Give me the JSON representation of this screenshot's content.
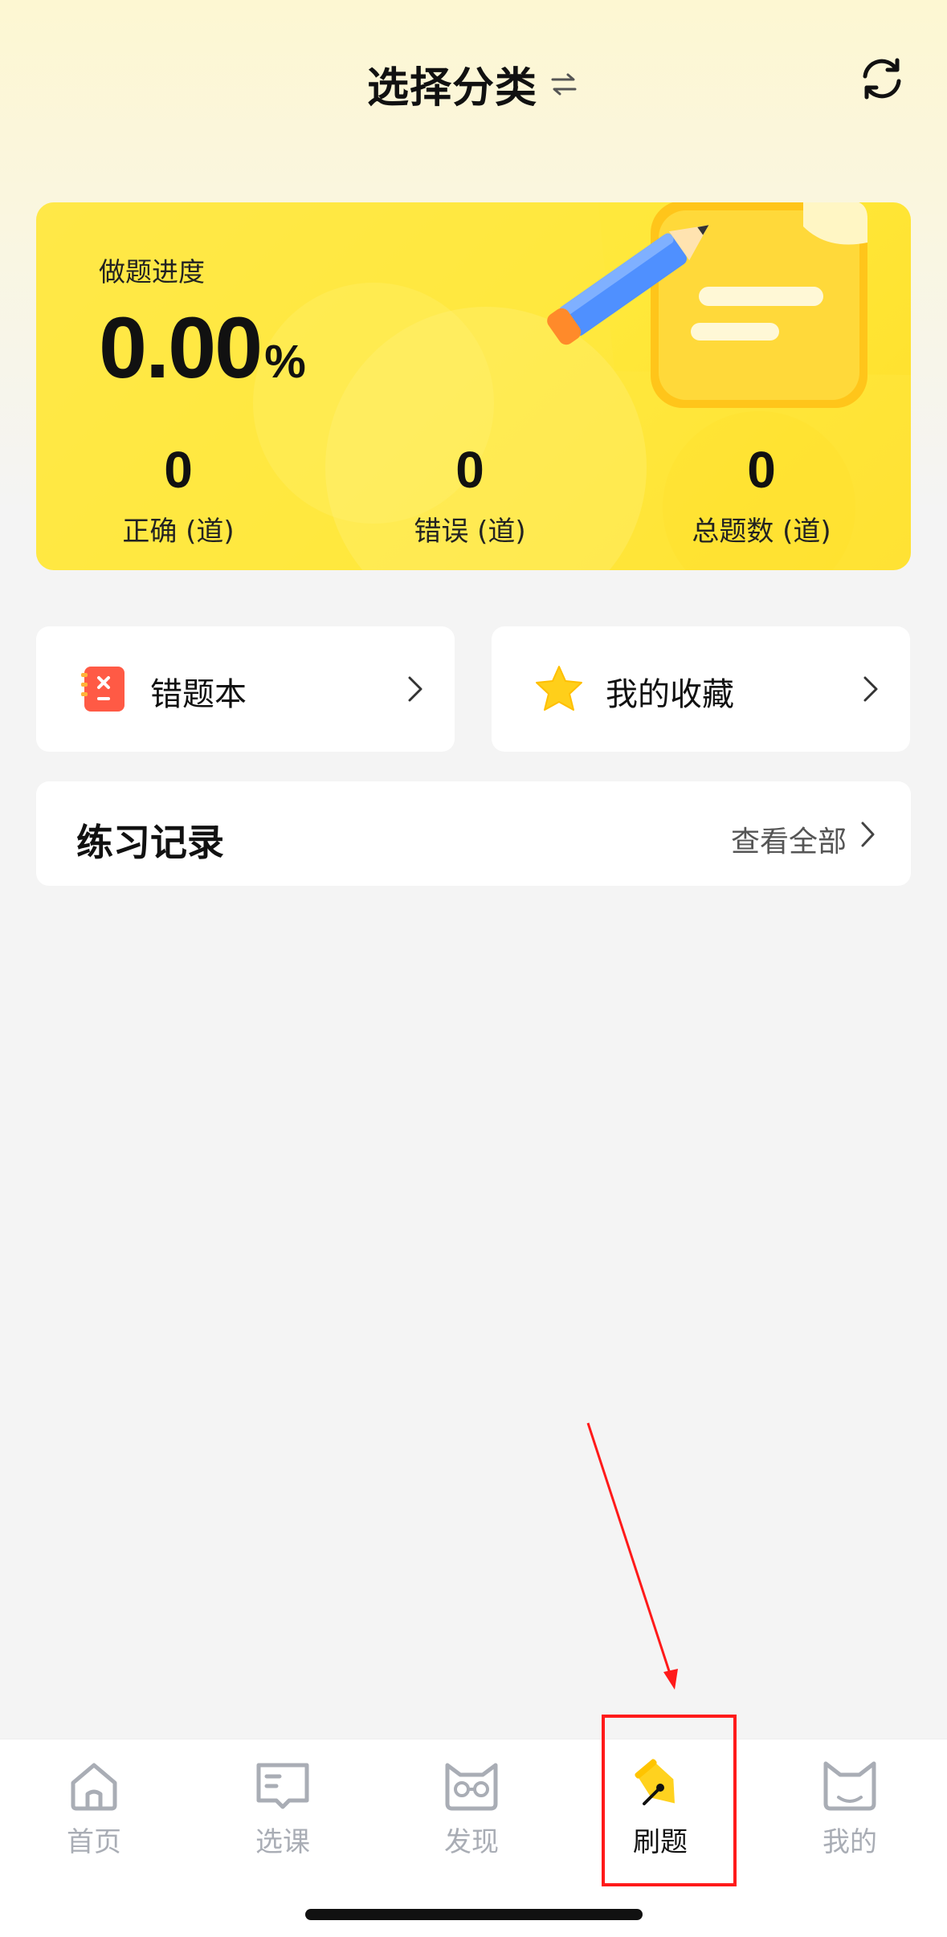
{
  "header": {
    "title": "选择分类"
  },
  "progress_card": {
    "label": "做题进度",
    "value": "0.00",
    "unit": "%",
    "stats": [
      {
        "value": "0",
        "label": "正确 (道)"
      },
      {
        "value": "0",
        "label": "错误 (道)"
      },
      {
        "value": "0",
        "label": "总题数 (道)"
      }
    ]
  },
  "tiles": {
    "wrong_book": "错题本",
    "favorites": "我的收藏"
  },
  "record": {
    "title": "练习记录",
    "more": "查看全部"
  },
  "tabbar": {
    "items": [
      {
        "label": "首页",
        "icon": "home-icon",
        "active": false
      },
      {
        "label": "选课",
        "icon": "book-icon",
        "active": false
      },
      {
        "label": "发现",
        "icon": "cat-glasses-icon",
        "active": false
      },
      {
        "label": "刷题",
        "icon": "pen-nib-icon",
        "active": true
      },
      {
        "label": "我的",
        "icon": "cat-profile-icon",
        "active": false
      }
    ]
  },
  "colors": {
    "card_yellow": "#ffe83a",
    "accent_yellow": "#ffd21f",
    "inactive_tab": "#a9adb5",
    "annotation_red": "#ff1a1a"
  }
}
